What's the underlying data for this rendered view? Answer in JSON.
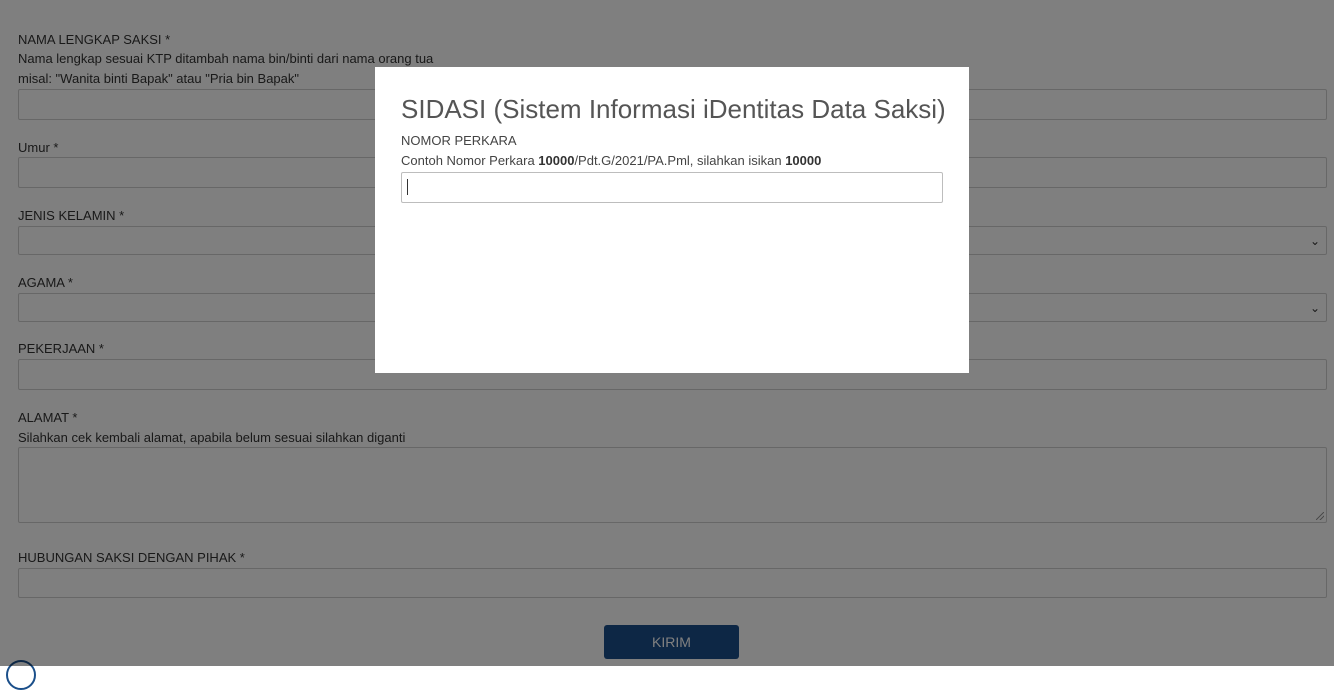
{
  "form": {
    "nama": {
      "label": "NAMA LENGKAP SAKSI *",
      "hint1": "Nama lengkap sesuai KTP ditambah nama bin/binti dari nama orang tua",
      "hint2": "misal: \"Wanita binti Bapak\" atau \"Pria bin Bapak\"",
      "value": ""
    },
    "umur": {
      "label": "Umur *",
      "value": ""
    },
    "jenis_kelamin": {
      "label": "JENIS KELAMIN *",
      "selected": ""
    },
    "agama": {
      "label": "AGAMA *",
      "selected": ""
    },
    "pekerjaan": {
      "label": "PEKERJAAN *",
      "value": ""
    },
    "alamat": {
      "label": "ALAMAT *",
      "hint": "Silahkan cek kembali alamat, apabila belum sesuai silahkan diganti",
      "value": ""
    },
    "hubungan": {
      "label": "HUBUNGAN SAKSI DENGAN PIHAK *",
      "value": ""
    },
    "submit_label": "KIRIM"
  },
  "modal": {
    "title": "SIDASI (Sistem Informasi iDentitas Data Saksi)",
    "field_label": "NOMOR PERKARA",
    "hint_prefix": "Contoh Nomor Perkara ",
    "hint_bold1": "10000",
    "hint_mid": "/Pdt.G/2021/PA.Pml, silahkan isikan ",
    "hint_bold2": "10000",
    "input_value": ""
  },
  "icons": {
    "select_chevron": "chevron-down-icon",
    "resize_grip": "resize-grip-icon"
  },
  "colors": {
    "submit_button": "#1b4f8a",
    "overlay": "rgba(0,0,0,0.5)"
  }
}
